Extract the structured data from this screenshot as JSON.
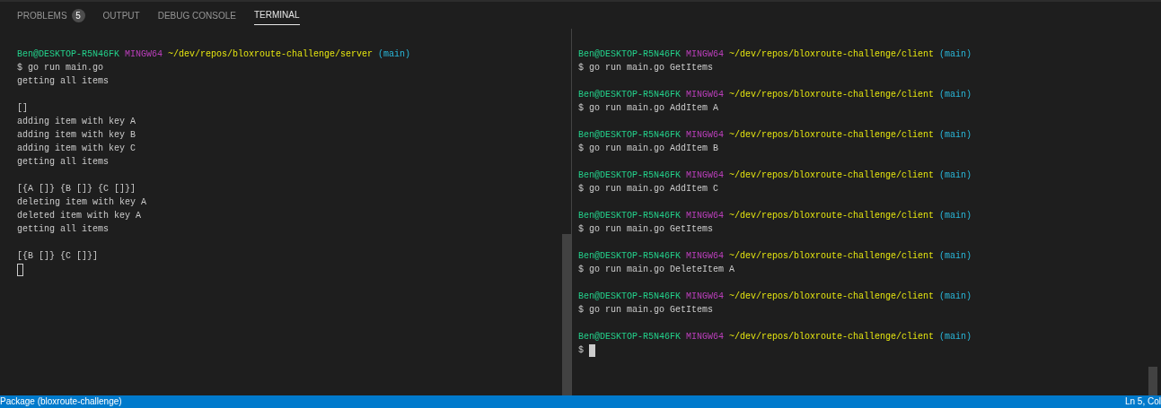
{
  "tabs": [
    {
      "label": "PROBLEMS",
      "badge": "5",
      "selected": false
    },
    {
      "label": "OUTPUT",
      "selected": false
    },
    {
      "label": "DEBUG CONSOLE",
      "selected": false
    },
    {
      "label": "TERMINAL",
      "selected": true
    }
  ],
  "panes": [
    {
      "lines": [
        {
          "kind": "prompt",
          "user": "Ben@DESKTOP-R5N46FK",
          "shell": "MINGW64",
          "path": "~/dev/repos/bloxroute-challenge/server",
          "branch": "(main)"
        },
        {
          "kind": "text",
          "text": "$ go run main.go"
        },
        {
          "kind": "text",
          "text": "getting all items"
        },
        {
          "kind": "blank"
        },
        {
          "kind": "text",
          "text": "[]"
        },
        {
          "kind": "text",
          "text": "adding item with key A"
        },
        {
          "kind": "text",
          "text": "adding item with key B"
        },
        {
          "kind": "text",
          "text": "adding item with key C"
        },
        {
          "kind": "text",
          "text": "getting all items"
        },
        {
          "kind": "blank"
        },
        {
          "kind": "text",
          "text": "[{A []} {B []} {C []}]"
        },
        {
          "kind": "text",
          "text": "deleting item with key A"
        },
        {
          "kind": "text",
          "text": "deleted item with key A"
        },
        {
          "kind": "text",
          "text": "getting all items"
        },
        {
          "kind": "blank"
        },
        {
          "kind": "text",
          "text": "[{B []} {C []}]"
        },
        {
          "kind": "cursor",
          "focused": false
        }
      ]
    },
    {
      "lines": [
        {
          "kind": "prompt",
          "user": "Ben@DESKTOP-R5N46FK",
          "shell": "MINGW64",
          "path": "~/dev/repos/bloxroute-challenge/client",
          "branch": "(main)"
        },
        {
          "kind": "text",
          "text": "$ go run main.go GetItems"
        },
        {
          "kind": "blank"
        },
        {
          "kind": "prompt",
          "user": "Ben@DESKTOP-R5N46FK",
          "shell": "MINGW64",
          "path": "~/dev/repos/bloxroute-challenge/client",
          "branch": "(main)"
        },
        {
          "kind": "text",
          "text": "$ go run main.go AddItem A"
        },
        {
          "kind": "blank"
        },
        {
          "kind": "prompt",
          "user": "Ben@DESKTOP-R5N46FK",
          "shell": "MINGW64",
          "path": "~/dev/repos/bloxroute-challenge/client",
          "branch": "(main)"
        },
        {
          "kind": "text",
          "text": "$ go run main.go AddItem B"
        },
        {
          "kind": "blank"
        },
        {
          "kind": "prompt",
          "user": "Ben@DESKTOP-R5N46FK",
          "shell": "MINGW64",
          "path": "~/dev/repos/bloxroute-challenge/client",
          "branch": "(main)"
        },
        {
          "kind": "text",
          "text": "$ go run main.go AddItem C"
        },
        {
          "kind": "blank"
        },
        {
          "kind": "prompt",
          "user": "Ben@DESKTOP-R5N46FK",
          "shell": "MINGW64",
          "path": "~/dev/repos/bloxroute-challenge/client",
          "branch": "(main)"
        },
        {
          "kind": "text",
          "text": "$ go run main.go GetItems"
        },
        {
          "kind": "blank"
        },
        {
          "kind": "prompt",
          "user": "Ben@DESKTOP-R5N46FK",
          "shell": "MINGW64",
          "path": "~/dev/repos/bloxroute-challenge/client",
          "branch": "(main)"
        },
        {
          "kind": "text",
          "text": "$ go run main.go DeleteItem A"
        },
        {
          "kind": "blank"
        },
        {
          "kind": "prompt",
          "user": "Ben@DESKTOP-R5N46FK",
          "shell": "MINGW64",
          "path": "~/dev/repos/bloxroute-challenge/client",
          "branch": "(main)"
        },
        {
          "kind": "text",
          "text": "$ go run main.go GetItems"
        },
        {
          "kind": "blank"
        },
        {
          "kind": "prompt",
          "user": "Ben@DESKTOP-R5N46FK",
          "shell": "MINGW64",
          "path": "~/dev/repos/bloxroute-challenge/client",
          "branch": "(main)"
        },
        {
          "kind": "input",
          "prompt": "$",
          "focused": true
        }
      ]
    }
  ],
  "status_bar": {
    "left": "Package (bloxroute-challenge)",
    "right": "Ln 5, Col"
  }
}
